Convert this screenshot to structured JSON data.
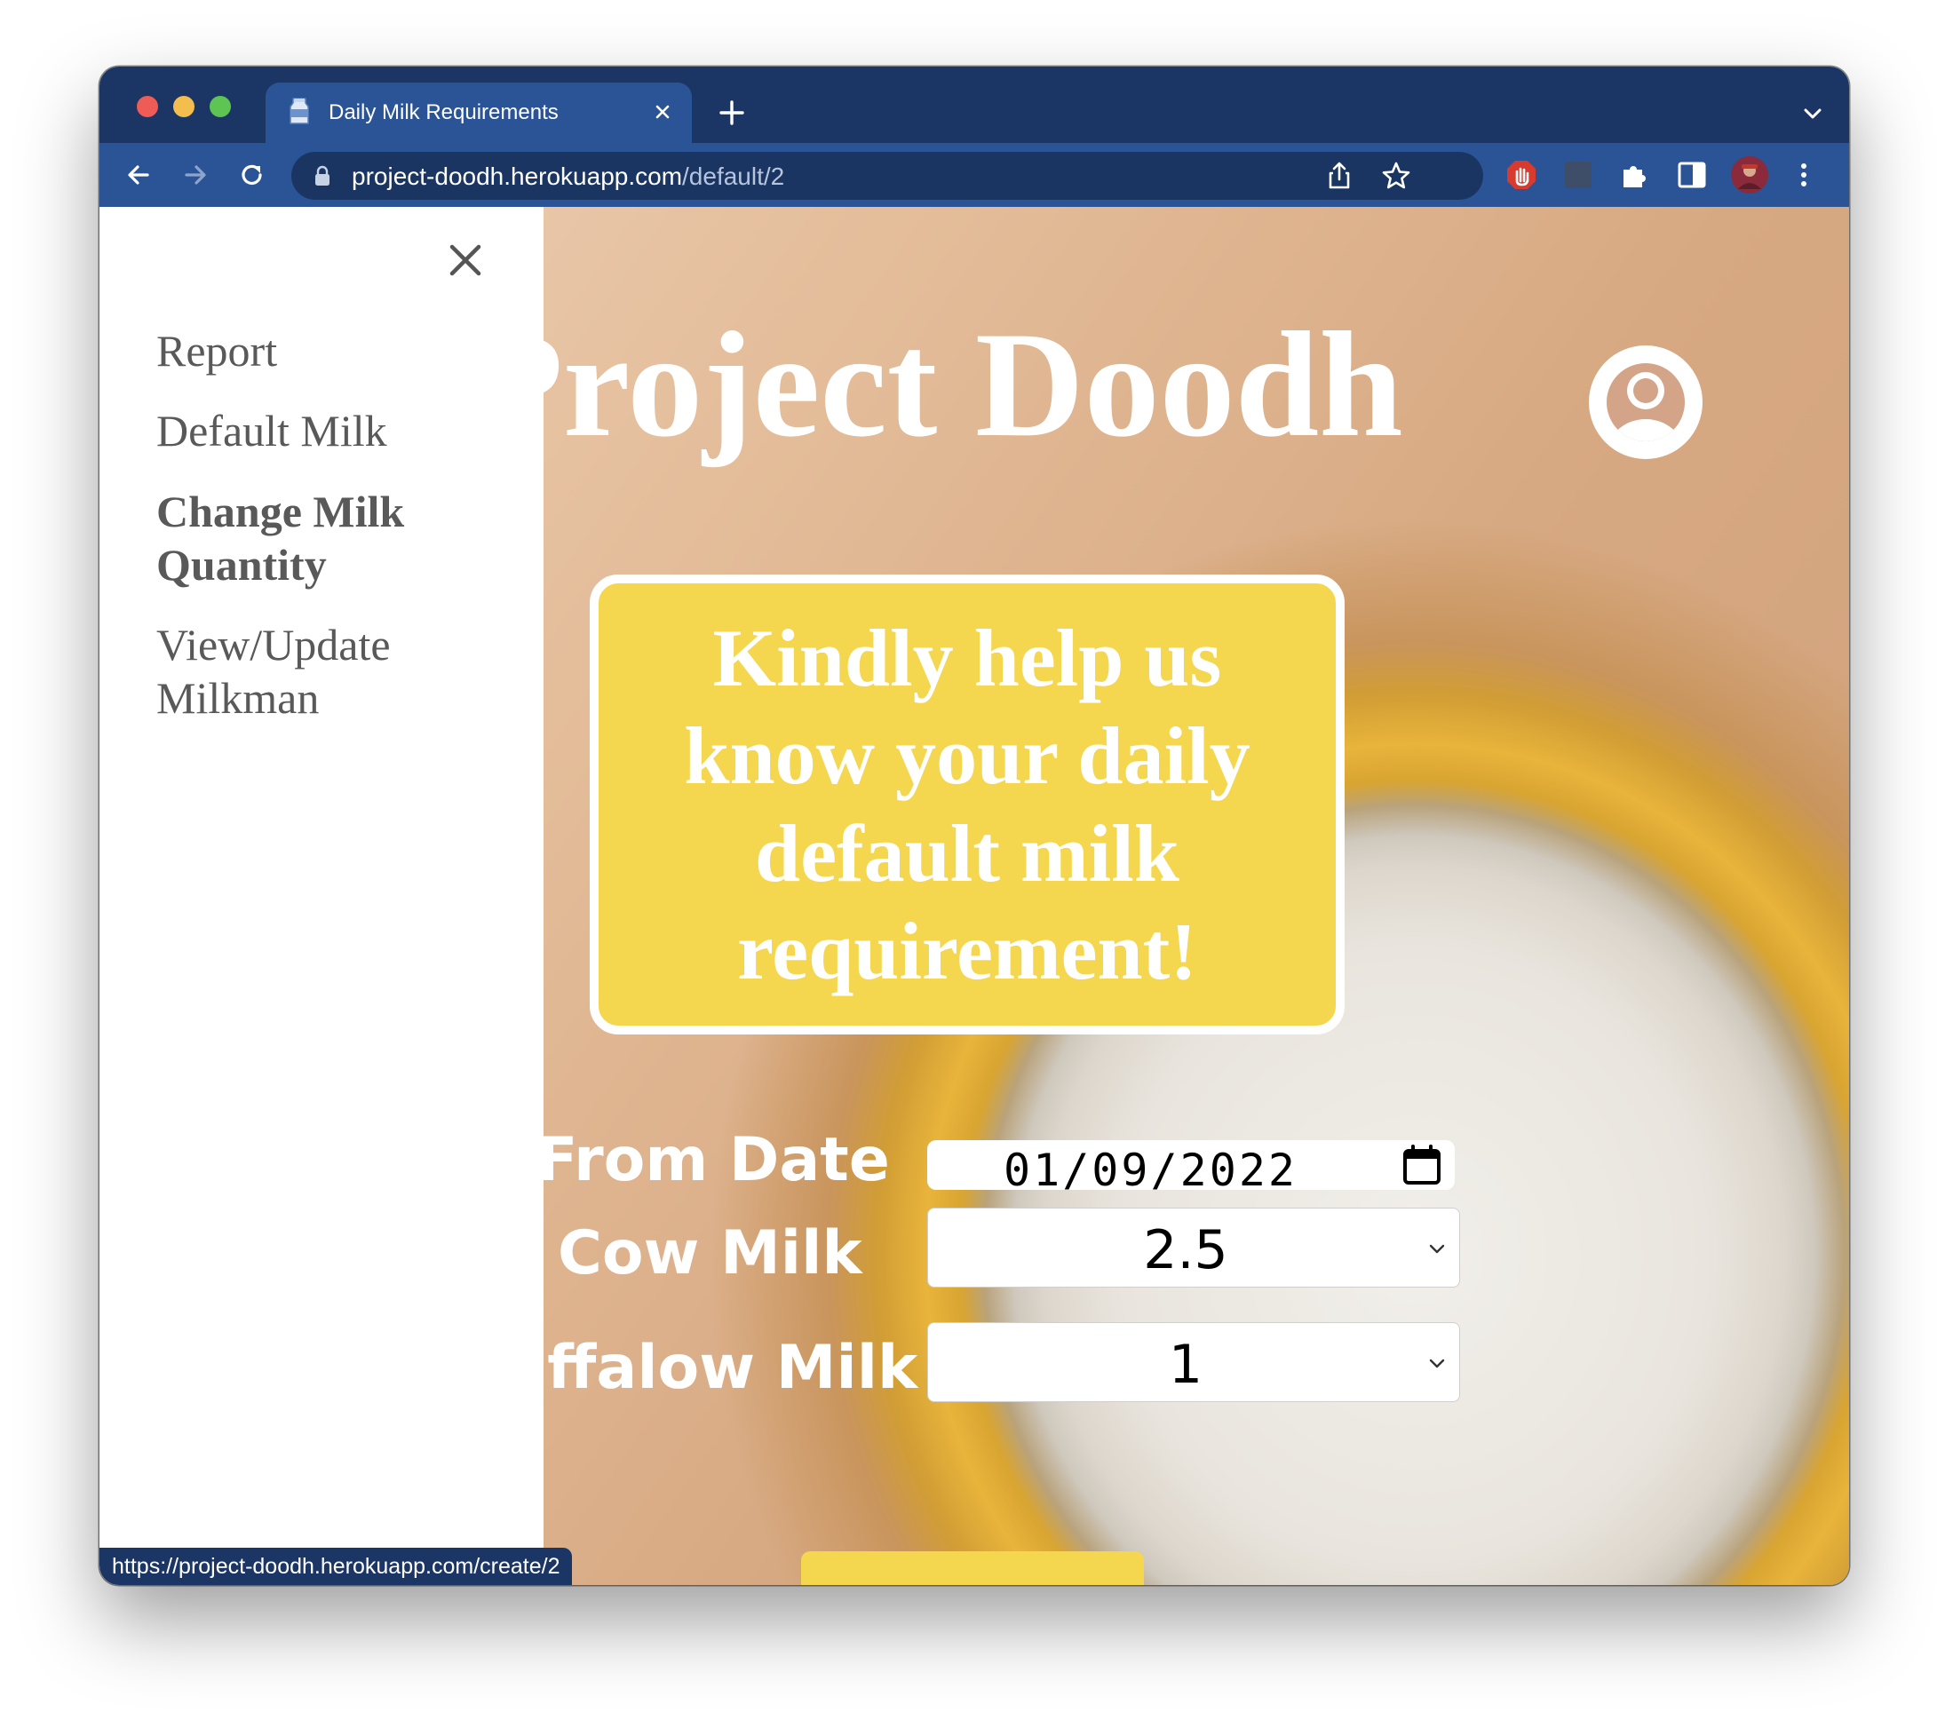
{
  "browser": {
    "tab": {
      "title": "Daily Milk Requirements"
    },
    "url": {
      "host": "project-doodh.herokuapp.com",
      "path": "/default/2"
    },
    "status_url": "https://project-doodh.herokuapp.com/create/2"
  },
  "page": {
    "title": "Project Doodh",
    "banner": "Kindly help us know your daily default milk requirement!",
    "form": {
      "from_date_label": "From Date",
      "from_date_value": "01/09/2022",
      "cow_milk_label": "Cow Milk",
      "cow_milk_value": "2.5",
      "buffalo_milk_label": "Buffalow Milk",
      "buffalo_milk_value": "1"
    }
  },
  "sidenav": {
    "items": [
      {
        "label": "Report",
        "active": false
      },
      {
        "label": "Default Milk",
        "active": false
      },
      {
        "label": "Change Milk Quantity",
        "active": true
      },
      {
        "label": "View/Update Milkman",
        "active": false
      }
    ]
  },
  "colors": {
    "tab_strip": "#1b3664",
    "toolbar": "#2a5496",
    "banner": "#f4d74e",
    "nav_text": "#595959"
  },
  "icons": {
    "back": "arrow-left-icon",
    "forward": "arrow-right-icon",
    "reload": "reload-icon",
    "lock": "lock-icon",
    "share": "share-icon",
    "bookmark": "star-icon",
    "profile": "user-circle-icon",
    "calendar": "calendar-icon",
    "close": "close-icon"
  }
}
